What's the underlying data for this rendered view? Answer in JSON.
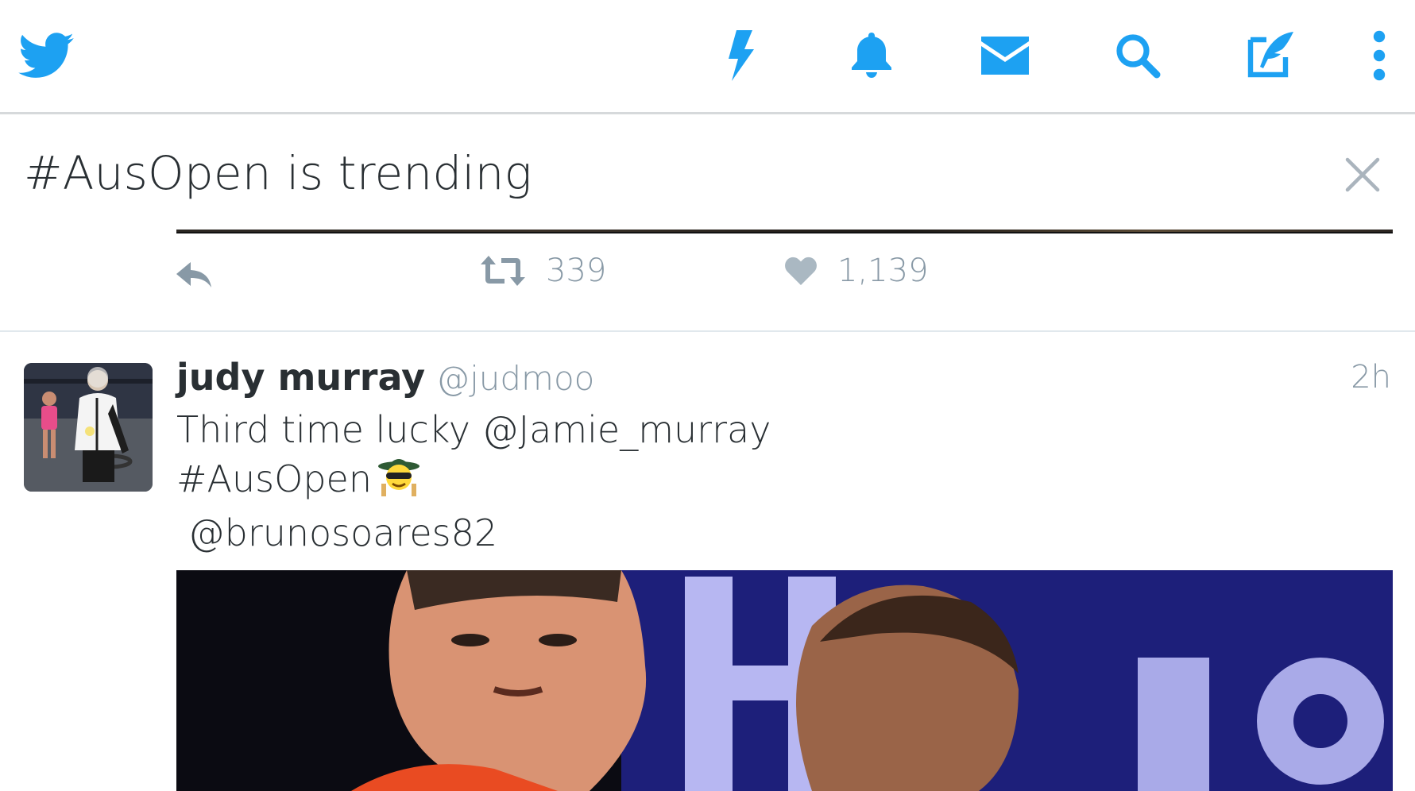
{
  "header": {
    "icons": [
      "twitter-bird-icon",
      "lightning-icon",
      "bell-icon",
      "mail-icon",
      "search-icon",
      "compose-icon",
      "more-vert-icon"
    ],
    "accent_color": "#1da1f2"
  },
  "trend": {
    "text": "#AusOpen is trending"
  },
  "prev_tweet": {
    "retweets": "339",
    "likes": "1,139"
  },
  "tweet": {
    "display_name": "judy murray",
    "handle": "@judmoo",
    "time": "2h",
    "lines": [
      "Third time lucky @Jamie_murray",
      "#AusOpen",
      " @brunosoares82"
    ]
  },
  "colors": {
    "text_primary": "#292f33",
    "text_secondary": "#8899a6",
    "divider": "#e1e8ed"
  }
}
